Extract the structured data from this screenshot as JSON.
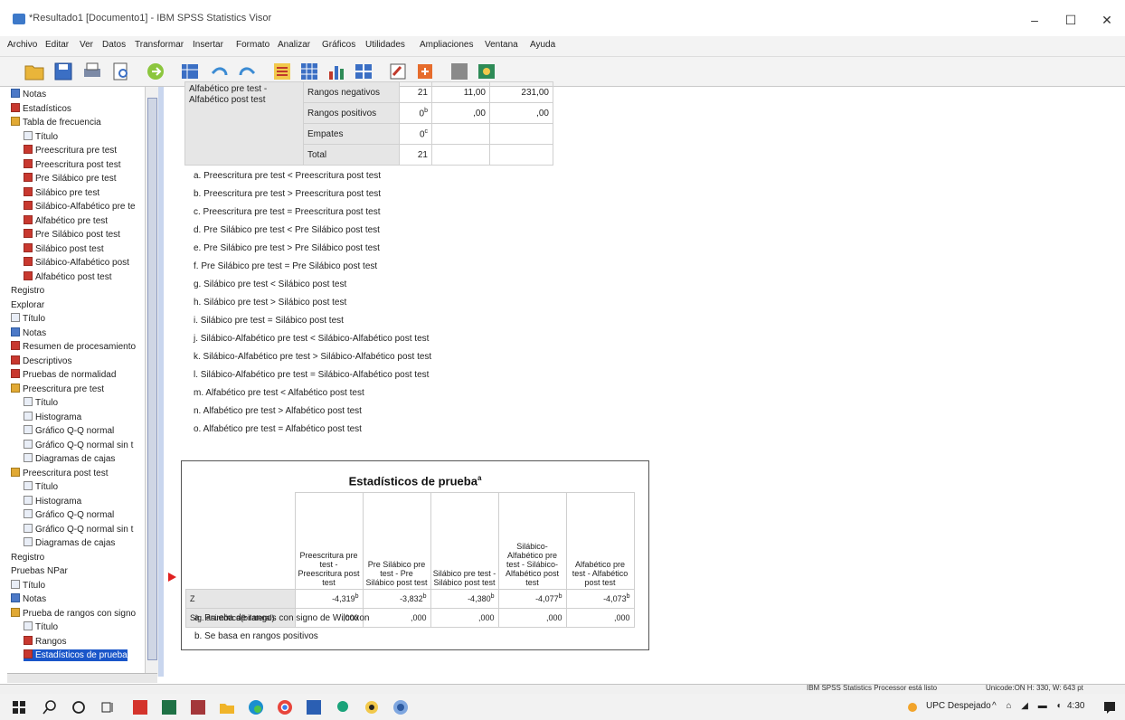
{
  "window": {
    "title": "*Resultado1 [Documento1] - IBM SPSS Statistics Visor",
    "minimize": "–",
    "maximize": "☐",
    "close": "✕"
  },
  "menu": [
    "Archivo",
    "Editar",
    "Ver",
    "Datos",
    "Transformar",
    "Insertar",
    "Formato",
    "Analizar",
    "Gráficos",
    "Utilidades",
    "Ampliaciones",
    "Ventana",
    "Ayuda"
  ],
  "nav": {
    "items": [
      {
        "label": "Notas",
        "icon": "notes-icon"
      },
      {
        "label": "Estadísticos",
        "icon": "table-icon"
      },
      {
        "label": "Tabla de frecuencia",
        "icon": "book-icon"
      },
      {
        "label": "Título",
        "icon": "title-icon"
      },
      {
        "label": "Preescritura pre test",
        "icon": "table-icon"
      },
      {
        "label": "Preescritura post test",
        "icon": "table-icon"
      },
      {
        "label": "Pre Silábico pre test",
        "icon": "table-icon"
      },
      {
        "label": "Silábico pre test",
        "icon": "table-icon"
      },
      {
        "label": "Silábico-Alfabético pre te",
        "icon": "table-icon"
      },
      {
        "label": "Alfabético pre test",
        "icon": "table-icon"
      },
      {
        "label": "Pre Silábico post test",
        "icon": "table-icon"
      },
      {
        "label": "Silábico post test",
        "icon": "table-icon"
      },
      {
        "label": "Silábico-Alfabético post",
        "icon": "table-icon"
      },
      {
        "label": "Alfabético post test",
        "icon": "table-icon"
      },
      {
        "label": "Registro",
        "icon": ""
      },
      {
        "label": "Explorar",
        "icon": ""
      },
      {
        "label": "Título",
        "icon": "title-icon"
      },
      {
        "label": "Notas",
        "icon": "notes-icon"
      },
      {
        "label": "Resumen de procesamiento",
        "icon": "table-icon"
      },
      {
        "label": "Descriptivos",
        "icon": "table-icon"
      },
      {
        "label": "Pruebas de normalidad",
        "icon": "table-icon"
      },
      {
        "label": "Preescritura pre test",
        "icon": "book-icon"
      },
      {
        "label": "Título",
        "icon": "title-icon"
      },
      {
        "label": "Histograma",
        "icon": "chart-icon"
      },
      {
        "label": "Gráfico Q-Q normal",
        "icon": "chart-icon"
      },
      {
        "label": "Gráfico Q-Q normal sin t",
        "icon": "chart-icon"
      },
      {
        "label": "Diagramas de cajas",
        "icon": "chart-icon"
      },
      {
        "label": "Preescritura post test",
        "icon": "book-icon"
      },
      {
        "label": "Título",
        "icon": "title-icon"
      },
      {
        "label": "Histograma",
        "icon": "chart-icon"
      },
      {
        "label": "Gráfico Q-Q normal",
        "icon": "chart-icon"
      },
      {
        "label": "Gráfico Q-Q normal sin t",
        "icon": "chart-icon"
      },
      {
        "label": "Diagramas de cajas",
        "icon": "chart-icon"
      },
      {
        "label": "Registro",
        "icon": ""
      },
      {
        "label": "Pruebas NPar",
        "icon": ""
      },
      {
        "label": "Título",
        "icon": "title-icon"
      },
      {
        "label": "Notas",
        "icon": "notes-icon"
      },
      {
        "label": "Prueba de rangos con signo",
        "icon": "book-icon"
      },
      {
        "label": "Título",
        "icon": "title-icon"
      },
      {
        "label": "Rangos",
        "icon": "table-icon"
      },
      {
        "label": "Estadísticos de prueba",
        "icon": "table-icon"
      }
    ]
  },
  "ranks": {
    "row0": {
      "label": "Alfabético pre test - Alfabético post test",
      "sub": "Rangos negativos",
      "n": "21",
      "mean": "11,00",
      "sum": "231,00"
    },
    "row1": {
      "sub": "Rangos positivos",
      "n": "0",
      "n_sup": "b",
      "mean": ",00",
      "sum": ",00"
    },
    "row2": {
      "sub": "Empates",
      "n": "0",
      "n_sup": "c"
    },
    "row3": {
      "sub": "Total",
      "n": "21"
    }
  },
  "footnotes": [
    "a. Preescritura pre test < Preescritura post test",
    "b. Preescritura pre test > Preescritura post test",
    "c. Preescritura pre test = Preescritura post test",
    "d. Pre Silábico pre test < Pre Silábico post test",
    "e. Pre Silábico pre test > Pre Silábico post test",
    "f. Pre Silábico pre test = Pre Silábico post test",
    "g. Silábico pre test < Silábico post test",
    "h. Silábico pre test > Silábico post test",
    "i. Silábico pre test = Silábico post test",
    "j. Silábico-Alfabético pre test < Silábico-Alfabético post test",
    "k. Silábico-Alfabético pre test > Silábico-Alfabético post test",
    "l. Silábico-Alfabético pre test = Silábico-Alfabético post test",
    "m. Alfabético pre test < Alfabético post test",
    "n. Alfabético pre test > Alfabético post test",
    "o. Alfabético pre test = Alfabético post test"
  ],
  "stats": {
    "title": "Estadísticos de prueba",
    "title_sup": "a",
    "columns": [
      "Preescritura pre test - Preescritura post test",
      "Pre Silábico pre test - Pre Silábico post test",
      "Silábico pre test - Silábico post test",
      "Silábico-Alfabético pre test - Silábico-Alfabético post test",
      "Alfabético pre test - Alfabético post test"
    ],
    "z_label": "Z",
    "z": [
      "-4,319",
      "-3,832",
      "-4,380",
      "-4,077",
      "-4,073"
    ],
    "z_sup": "b",
    "sig_label": "Sig. asintótica(bilateral)",
    "sig": [
      ",000",
      ",000",
      ",000",
      ",000",
      ",000"
    ],
    "notes": [
      "a. Prueba de rangos con signo de Wilcoxon",
      "b. Se basa en rangos positivos"
    ]
  },
  "status": {
    "left": "IBM SPSS Statistics Processor está listo",
    "right": "Unicode:ON   H: 330, W: 643 pt"
  },
  "taskbar": {
    "tray_text": "UPC Despejado",
    "time": "4:30"
  },
  "colors": {
    "accent": "#1a56c9",
    "grey_cell": "#e6e6e6"
  }
}
